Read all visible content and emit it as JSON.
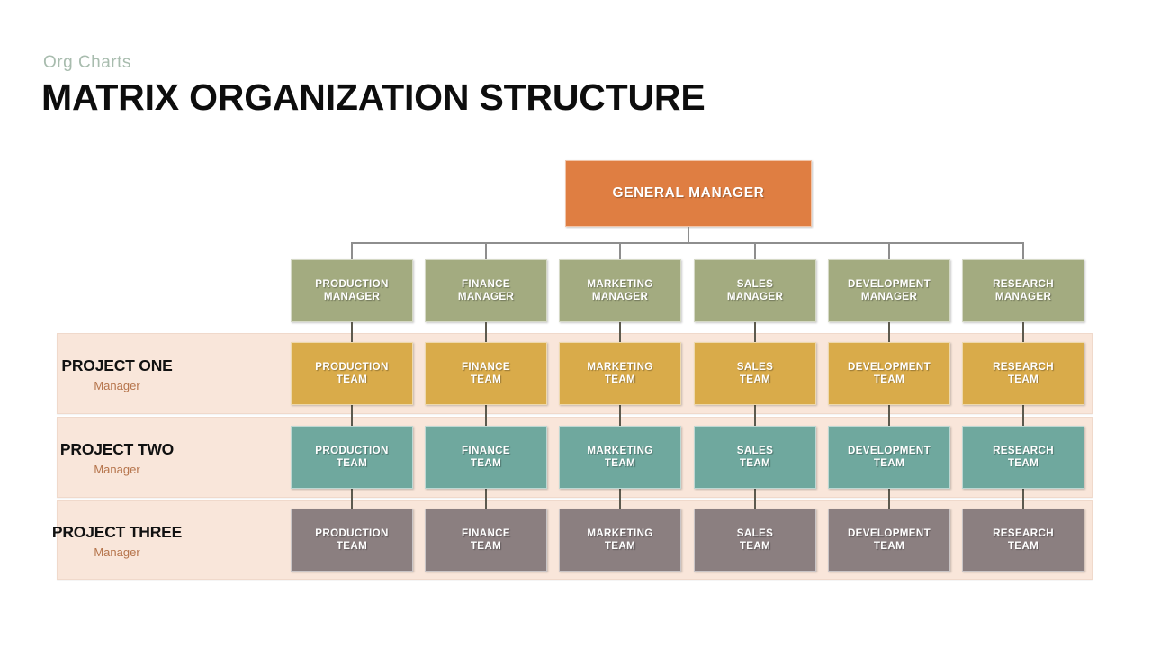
{
  "header": {
    "eyebrow": "Org Charts",
    "title": "MATRIX ORGANIZATION STRUCTURE"
  },
  "colors": {
    "general_manager": "#df7e42",
    "manager_row": "#a3ab80",
    "project_one_team": "#d9ab4a",
    "project_two_team": "#6fa89e",
    "project_three_team": "#8b7f80",
    "band_background": "#f9e6da",
    "band_border": "#f0d9cb",
    "eyebrow_text": "#a8bcae",
    "role_text": "#b5734a",
    "connector_line": "#8e8e8e",
    "title_text": "#0d0d0d"
  },
  "chart_data": {
    "type": "diagram",
    "title": "MATRIX ORGANIZATION STRUCTURE",
    "root": {
      "label": "GENERAL MANAGER"
    },
    "departments": [
      "PRODUCTION",
      "FINANCE",
      "MARKETING",
      "SALES",
      "DEVELOPMENT",
      "RESEARCH"
    ],
    "manager_row": [
      {
        "label": "PRODUCTION\nMANAGER"
      },
      {
        "label": "FINANCE\nMANAGER"
      },
      {
        "label": "MARKETING\nMANAGER"
      },
      {
        "label": "SALES\nMANAGER"
      },
      {
        "label": "DEVELOPMENT\nMANAGER"
      },
      {
        "label": "RESEARCH\nMANAGER"
      }
    ],
    "projects": [
      {
        "name": "PROJECT ONE",
        "role": "Manager",
        "color": "#d9ab4a",
        "teams": [
          {
            "label": "PRODUCTION\nTEAM"
          },
          {
            "label": "FINANCE\nTEAM"
          },
          {
            "label": "MARKETING\nTEAM"
          },
          {
            "label": "SALES\nTEAM"
          },
          {
            "label": "DEVELOPMENT\nTEAM"
          },
          {
            "label": "RESEARCH\nTEAM"
          }
        ]
      },
      {
        "name": "PROJECT TWO",
        "role": "Manager",
        "color": "#6fa89e",
        "teams": [
          {
            "label": "PRODUCTION\nTEAM"
          },
          {
            "label": "FINANCE\nTEAM"
          },
          {
            "label": "MARKETING\nTEAM"
          },
          {
            "label": "SALES\nTEAM"
          },
          {
            "label": "DEVELOPMENT\nTEAM"
          },
          {
            "label": "RESEARCH\nTEAM"
          }
        ]
      },
      {
        "name": "PROJECT THREE",
        "role": "Manager",
        "color": "#8b7f80",
        "teams": [
          {
            "label": "PRODUCTION\nTEAM"
          },
          {
            "label": "FINANCE\nTEAM"
          },
          {
            "label": "MARKETING\nTEAM"
          },
          {
            "label": "SALES\nTEAM"
          },
          {
            "label": "DEVELOPMENT\nTEAM"
          },
          {
            "label": "RESEARCH\nTEAM"
          }
        ]
      }
    ]
  }
}
